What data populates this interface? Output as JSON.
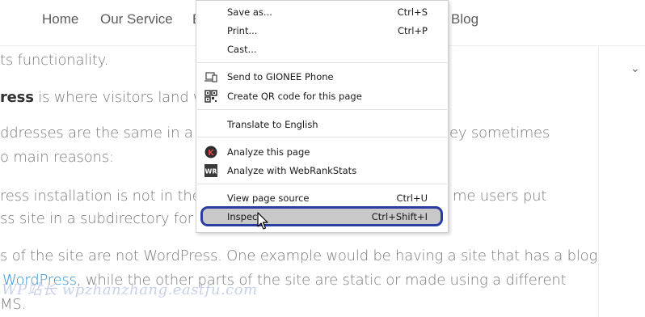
{
  "nav": {
    "items": [
      "Home",
      "Our Service",
      "Blog"
    ]
  },
  "article": {
    "line1": "ts functionality.",
    "line2_bold": "ress",
    "line2_rest": " is where visitors land whe",
    "line3_left": "ddresses are the same in a def",
    "line3_right": "ey sometimes",
    "line4": "o main reasons:",
    "line5_left": "ress installation is not in the ro",
    "line5_right": "me users put",
    "line6": "ss site in a subdirectory for se",
    "line7": "s of the site are not WordPress. One example would be having a site that has a blog",
    "line8_link": "WordPress",
    "line8_rest": ", while the other parts of the site are static or made using a different",
    "line9": "MS."
  },
  "watermark": "WP站长  wpzhanzhang.eastfu.com",
  "context_menu": {
    "items": [
      {
        "label": "Save as...",
        "shortcut": "Ctrl+S"
      },
      {
        "label": "Print...",
        "shortcut": "Ctrl+P"
      },
      {
        "label": "Cast...",
        "shortcut": ""
      },
      {
        "label": "Send to GIONEE Phone",
        "shortcut": "",
        "icon": "send-to-device-icon"
      },
      {
        "label": "Create QR code for this page",
        "shortcut": "",
        "icon": "qr-code-icon"
      },
      {
        "label": "Translate to English",
        "shortcut": ""
      },
      {
        "label": "Analyze this page",
        "shortcut": "",
        "icon": "k-extension-icon"
      },
      {
        "label": "Analyze with WebRankStats",
        "shortcut": "",
        "icon": "webrankstats-icon"
      },
      {
        "label": "View page source",
        "shortcut": "Ctrl+U"
      },
      {
        "label": "Inspect",
        "shortcut": "Ctrl+Shift+I"
      }
    ],
    "highlight_color": "#2a3ea0"
  }
}
